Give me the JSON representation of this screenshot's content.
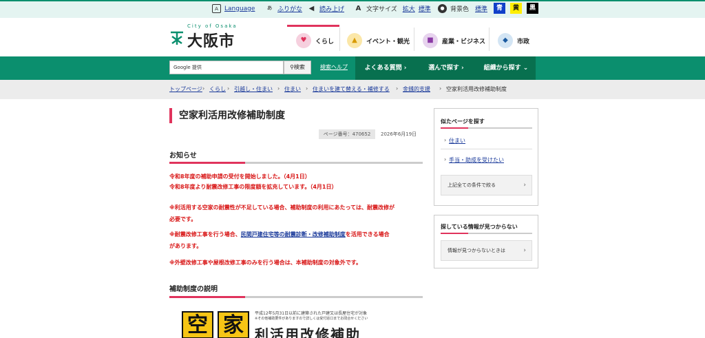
{
  "topbar": {
    "language": "Language",
    "furigana": "ふりがな",
    "read_aloud": "読み上げ",
    "text_size_label": "文字サイズ",
    "text_size_enlarge": "拡大",
    "text_size_standard": "標準",
    "bg_color_label": "背景色",
    "bg_standard": "標準",
    "bg_blue": "青",
    "bg_yellow": "黄",
    "bg_black": "黒"
  },
  "header": {
    "logo_text": "大阪市",
    "logo_sub": "City of Osaka",
    "categories": [
      {
        "label": "くらし",
        "color": "#f6d0de",
        "glyph": "♥"
      },
      {
        "label": "イベント・観光",
        "color": "#fbe7a8",
        "glyph": "▲"
      },
      {
        "label": "産業・ビジネス",
        "color": "#e7d3ee",
        "glyph": "■"
      },
      {
        "label": "市政",
        "color": "#d3e5f4",
        "glyph": "◆"
      }
    ]
  },
  "nav": {
    "search_provider": "Google 提供",
    "search_button": "検索",
    "search_help": "検索ヘルプ",
    "tabs": [
      "よくある質問 ›",
      "選んで探す ›",
      "組織から探す ⌄"
    ]
  },
  "breadcrumbs": [
    "トップページ",
    "くらし",
    "引越し・住まい",
    "住まい",
    "住まいを建て替える・補修する",
    "金銭的支援"
  ],
  "breadcrumb_current": "空家利活用改修補助制度",
  "page": {
    "title": "空家利活用改修補助制度",
    "page_number": "ページ番号：470652",
    "date": "2026年6月19日",
    "notice_heading": "お知らせ",
    "notice_line1": "令和8年度の補助申請の受付を開始しました。（4月1日）",
    "notice_line2": "令和8年度より耐震改修工事の限度額を拡充しています。（4月1日）",
    "note1_a": "※利活用する空家の耐震性が不足している場合、補助制度の利用にあたっては、耐震改修が",
    "note1_b": "必要です。",
    "note2_pre": "※耐震改修工事を行う場合、",
    "note2_link": "民間戸建住宅等の耐震診断・改修補助制度",
    "note2_post": "を活用できる場合",
    "note2_b": "があります。",
    "note3": "※外壁改修工事や屋根改修工事のみを行う場合は、本補助制度の対象外です。",
    "explain_heading": "補助制度の説明",
    "banner_char1": "空",
    "banner_char2": "家",
    "banner_small1": "平成12年5月31日以前に建築された戸建又は長屋住宅が対象",
    "banner_small2": "※その他補助要件がありますので詳しくは受付窓口までお問合せください",
    "banner_big": "利活用改修補助"
  },
  "sidebar": {
    "similar_heading": "似たページを探す",
    "similar_links": [
      "住まい",
      "手当・助成を受けたい"
    ],
    "narrow_button": "上記全ての条件で絞る",
    "notfound_heading": "探している情報が見つからない",
    "notfound_button": "情報が見つからないときは"
  },
  "colors": {
    "brand_green": "#0b8f6e",
    "accent_pink": "#e0335c",
    "notice_red": "#d81414",
    "link_blue": "#1a3a9a"
  }
}
